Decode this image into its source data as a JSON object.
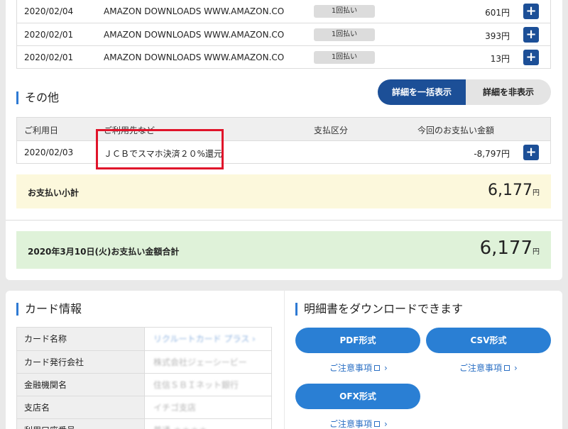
{
  "transactions": [
    {
      "date": "2020/02/04",
      "shop": "AMAZON DOWNLOADS WWW.AMAZON.CO",
      "pay": "1回払い",
      "amount": "601円"
    },
    {
      "date": "2020/02/01",
      "shop": "AMAZON DOWNLOADS WWW.AMAZON.CO",
      "pay": "1回払い",
      "amount": "393円"
    },
    {
      "date": "2020/02/01",
      "shop": "AMAZON DOWNLOADS WWW.AMAZON.CO",
      "pay": "1回払い",
      "amount": "13円"
    }
  ],
  "other": {
    "title": "その他",
    "show_all": "詳細を一括表示",
    "hide_all": "詳細を非表示",
    "headers": {
      "date": "ご利用日",
      "shop": "ご利用先など",
      "pay": "支払区分",
      "amount": "今回のお支払い金額"
    },
    "row": {
      "date": "2020/02/03",
      "shop": "ＪＣＢでスマホ決済２０%還元",
      "amount": "-8,797円"
    }
  },
  "subtotal": {
    "label": "お支払い小計",
    "value": "6,177",
    "unit": "円"
  },
  "total": {
    "label": "2020年3月10日(火)お支払い金額合計",
    "value": "6,177",
    "unit": "円"
  },
  "card_info": {
    "title": "カード情報",
    "rows": [
      {
        "label": "カード名称",
        "value": "リクルートカード プラス ›"
      },
      {
        "label": "カード発行会社",
        "value": "株式会社ジェーシービー"
      },
      {
        "label": "金融機関名",
        "value": "住信ＳＢＩネット銀行"
      },
      {
        "label": "支店名",
        "value": "イチゴ支店"
      },
      {
        "label": "利用口座番号",
        "value": "普通 ＊＊＊＊"
      }
    ]
  },
  "download": {
    "title": "明細書をダウンロードできます",
    "pdf": "PDF形式",
    "csv": "CSV形式",
    "ofx": "OFX形式",
    "notice": "ご注意事項"
  },
  "icons": {
    "plus": "+",
    "chevron": "›"
  },
  "colors": {
    "navy": "#1c4f97",
    "blue": "#2a7fd4",
    "highlight": "#e0142a",
    "subtotal_bg": "#fcf8dc",
    "total_bg": "#dff2d9"
  }
}
